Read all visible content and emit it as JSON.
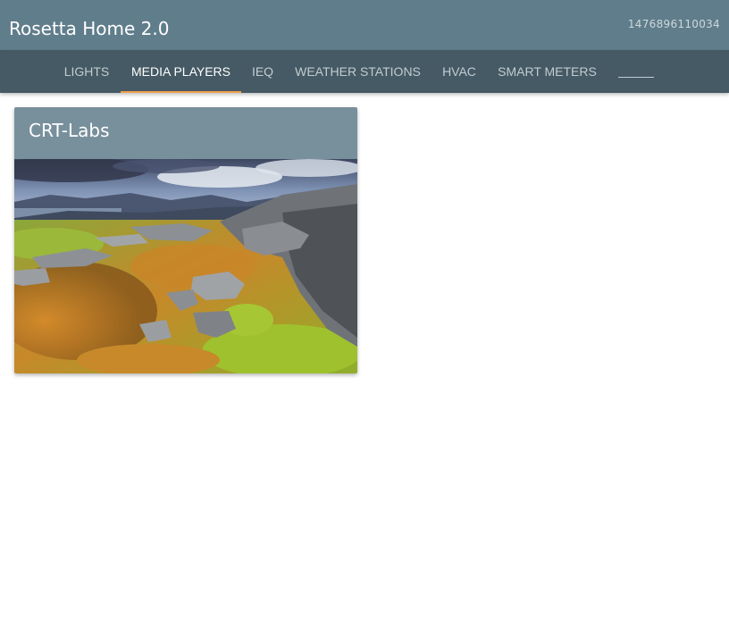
{
  "app": {
    "title": "Rosetta Home 2.0",
    "timestamp": "1476896110034"
  },
  "tabs": [
    {
      "label": "LIGHTS",
      "active": false
    },
    {
      "label": "MEDIA PLAYERS",
      "active": true
    },
    {
      "label": "IEQ",
      "active": false
    },
    {
      "label": "WEATHER STATIONS",
      "active": false
    },
    {
      "label": "HVAC",
      "active": false
    },
    {
      "label": "SMART METERS",
      "active": false
    }
  ],
  "card": {
    "title": "CRT-Labs",
    "image_icon": "landscape-image"
  },
  "colors": {
    "topbar": "#607d8b",
    "tabbar": "#455a64",
    "card_header": "#78909c",
    "active_indicator": "#f0a04b"
  }
}
